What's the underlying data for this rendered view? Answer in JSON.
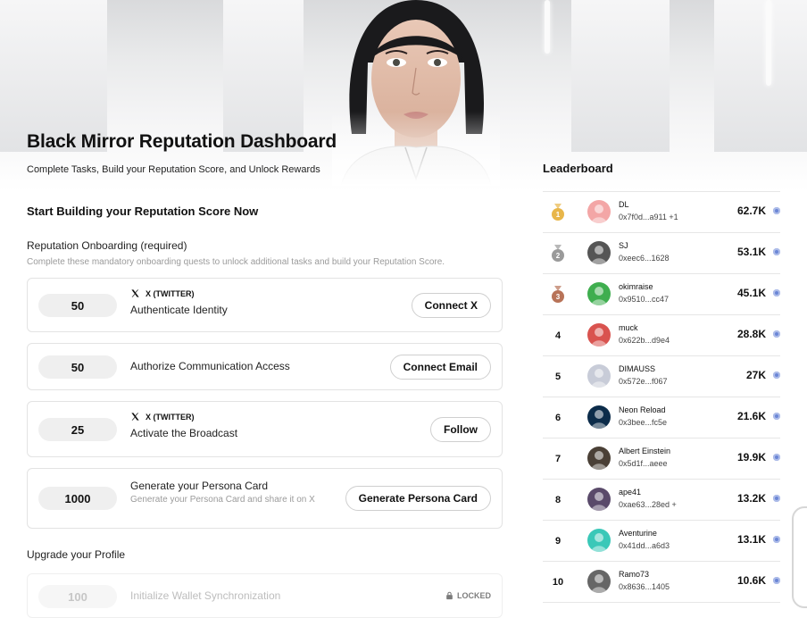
{
  "header": {
    "title": "Black Mirror Reputation Dashboard",
    "subtitle": "Complete Tasks, Build your Reputation Score, and Unlock Rewards"
  },
  "main": {
    "section_title": "Start Building your Reputation Score Now",
    "onboarding": {
      "title": "Reputation Onboarding (required)",
      "description": "Complete these mandatory onboarding quests to unlock additional tasks and build your Reputation Score.",
      "quests": [
        {
          "points": "50",
          "platform": "X (TWITTER)",
          "name": "Authenticate Identity",
          "button": "Connect X"
        },
        {
          "points": "50",
          "platform": "",
          "name": "Authorize Communication Access",
          "button": "Connect Email"
        },
        {
          "points": "25",
          "platform": "X (TWITTER)",
          "name": "Activate the Broadcast",
          "button": "Follow"
        },
        {
          "points": "1000",
          "platform": "",
          "name": "Generate your Persona Card",
          "sub": "Generate your Persona Card and share it on X",
          "button": "Generate Persona Card"
        }
      ]
    },
    "upgrade": {
      "title": "Upgrade your Profile",
      "quests": [
        {
          "points": "100",
          "name": "Initialize Wallet Synchronization",
          "status": "LOCKED"
        }
      ]
    }
  },
  "leaderboard": {
    "title": "Leaderboard",
    "accent": "#6b86d6",
    "rows": [
      {
        "rank": "1",
        "name": "DL",
        "address": "0x7f0d...a911 +1",
        "score": "62.7K",
        "avatar_color": "#f3a6a6"
      },
      {
        "rank": "2",
        "name": "SJ",
        "address": "0xeec6...1628",
        "score": "53.1K",
        "avatar_color": "#555555"
      },
      {
        "rank": "3",
        "name": "okimraise",
        "address": "0x9510...cc47",
        "score": "45.1K",
        "avatar_color": "#3fae4f"
      },
      {
        "rank": "4",
        "name": "muck",
        "address": "0x622b...d9e4",
        "score": "28.8K",
        "avatar_color": "#d9534f"
      },
      {
        "rank": "5",
        "name": "DIMAUSS",
        "address": "0x572e...f067",
        "score": "27K",
        "avatar_color": "#c8ccd8"
      },
      {
        "rank": "6",
        "name": "Neon Reload",
        "address": "0x3bee...fc5e",
        "score": "21.6K",
        "avatar_color": "#0c2c4a"
      },
      {
        "rank": "7",
        "name": "Albert Einstein",
        "address": "0x5d1f...aeee",
        "score": "19.9K",
        "avatar_color": "#4a4036"
      },
      {
        "rank": "8",
        "name": "ape41",
        "address": "0xae63...28ed +",
        "score": "13.2K",
        "avatar_color": "#5a4a6a"
      },
      {
        "rank": "9",
        "name": "Aventurine",
        "address": "0x41dd...a6d3",
        "score": "13.1K",
        "avatar_color": "#3ac8b8"
      },
      {
        "rank": "10",
        "name": "Ramo73",
        "address": "0x8636...1405",
        "score": "10.6K",
        "avatar_color": "#666666"
      }
    ]
  }
}
